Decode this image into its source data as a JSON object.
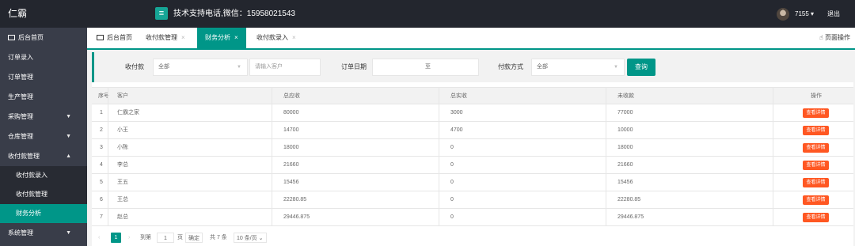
{
  "header": {
    "logo": "仁霸",
    "menu_icon": "≡",
    "support": "技术支持电话,微信：15958021543",
    "user": "7155 ▾",
    "logout": "退出"
  },
  "sidebar": {
    "home": "后台首页",
    "items": [
      {
        "label": "订单录入",
        "caret": ""
      },
      {
        "label": "订单管理",
        "caret": ""
      },
      {
        "label": "生产管理",
        "caret": ""
      },
      {
        "label": "采购管理",
        "caret": "▼"
      },
      {
        "label": "仓库管理",
        "caret": "▼"
      },
      {
        "label": "收付款管理",
        "caret": "▲"
      }
    ],
    "subitems": [
      "收付款录入",
      "收付款管理",
      "财务分析"
    ],
    "last": {
      "label": "系统管理",
      "caret": "▼"
    }
  },
  "tabs": {
    "home": "后台首页",
    "items": [
      {
        "label": "收付款管理",
        "close": "×"
      },
      {
        "label": "财务分析",
        "close": "×"
      },
      {
        "label": "收付款录入",
        "close": "×"
      }
    ],
    "page_ops": "页面操作"
  },
  "filter": {
    "type_label": "收付款",
    "type_value": "全部",
    "customer_placeholder": "请输入客户",
    "date_label": "订单日期",
    "date_sep": "至",
    "pay_label": "付款方式",
    "pay_value": "全部",
    "query": "查询"
  },
  "table": {
    "columns": [
      "序号",
      "客户",
      "总应收",
      "总实收",
      "未收款",
      "操作"
    ],
    "detail_label": "查看详情",
    "rows": [
      [
        "1",
        "仁霸之家",
        "80000",
        "3000",
        "77000"
      ],
      [
        "2",
        "小王",
        "14700",
        "4700",
        "10000"
      ],
      [
        "3",
        "小陈",
        "18000",
        "0",
        "18000"
      ],
      [
        "4",
        "李总",
        "21660",
        "0",
        "21660"
      ],
      [
        "5",
        "王五",
        "15456",
        "0",
        "15456"
      ],
      [
        "6",
        "王总",
        "22280.85",
        "0",
        "22280.85"
      ],
      [
        "7",
        "赵总",
        "29446.875",
        "0",
        "29446.875"
      ]
    ]
  },
  "pagination": {
    "prev": "‹",
    "current": "1",
    "next": "›",
    "goto_label": "到第",
    "goto_value": "1",
    "page_unit": "页",
    "confirm": "确定",
    "total": "共 7 条",
    "per_page": "10 条/页 ⌄"
  },
  "colors": {
    "header_bg": "#23262e",
    "sidebar_bg": "#393d49",
    "accent": "#009688",
    "danger": "#ff5722"
  }
}
